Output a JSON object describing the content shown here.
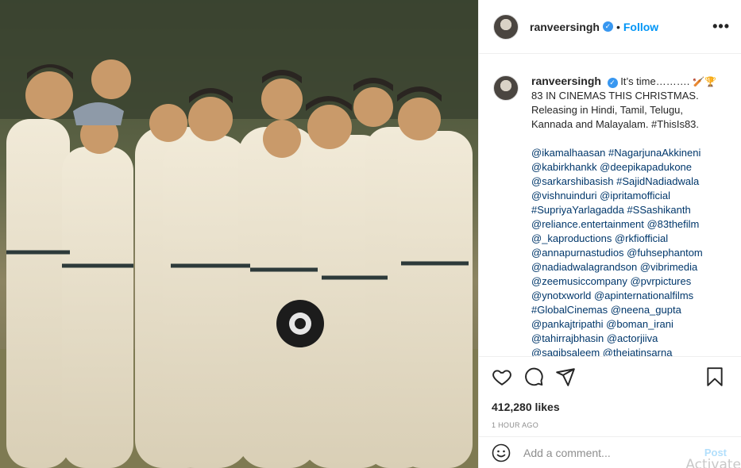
{
  "header": {
    "username": "ranveersingh",
    "separator": "•",
    "follow_label": "Follow",
    "more_label": "•••"
  },
  "caption": {
    "username": "ranveersingh",
    "text": "It’s time……….",
    "text2": "83 IN CINEMAS THIS CHRISTMAS.\nReleasing in Hindi, Tamil, Telugu,\nKannada and Malayalam. #ThisIs83.",
    "tags": "@ikamalhaasan #NagarjunaAkkineni\n@kabirkhankk @deepikapadukone\n@sarkarshibasish #SajidNadiadwala\n@vishnuinduri @ipritamofficial\n#SupriyaYarlagadda #SSashikanth\n@reliance.entertainment @83thefilm\n@_kaproductions @rkfiofficial\n@annapurnastudios @fuhsephantom\n@nadiadwalagrandson @vibrimedia\n@zeemusiccompany @pvrpictures\n@ynotxworld @apinternationalfilms\n#GlobalCinemas @neena_gupta\n@pankajtripathi @boman_irani\n@tahirrajbhasin @actorjiiva\n@saqibsaleem @theiatinsarna"
  },
  "icons": {
    "like": "heart-icon",
    "comment": "comment-icon",
    "share": "paper-plane-icon",
    "save": "bookmark-icon",
    "emoji": "smiley-icon",
    "verified": "verified-badge-icon"
  },
  "stats": {
    "likes": "412,280 likes",
    "time": "1 HOUR AGO"
  },
  "add_comment": {
    "placeholder": "Add a comment...",
    "post_label": "Post"
  },
  "watermark": "Activate",
  "colors": {
    "accent": "#0095f6",
    "verified": "#3897f0",
    "post_disabled": "#b2dffc",
    "muted": "#8e8e8e"
  }
}
